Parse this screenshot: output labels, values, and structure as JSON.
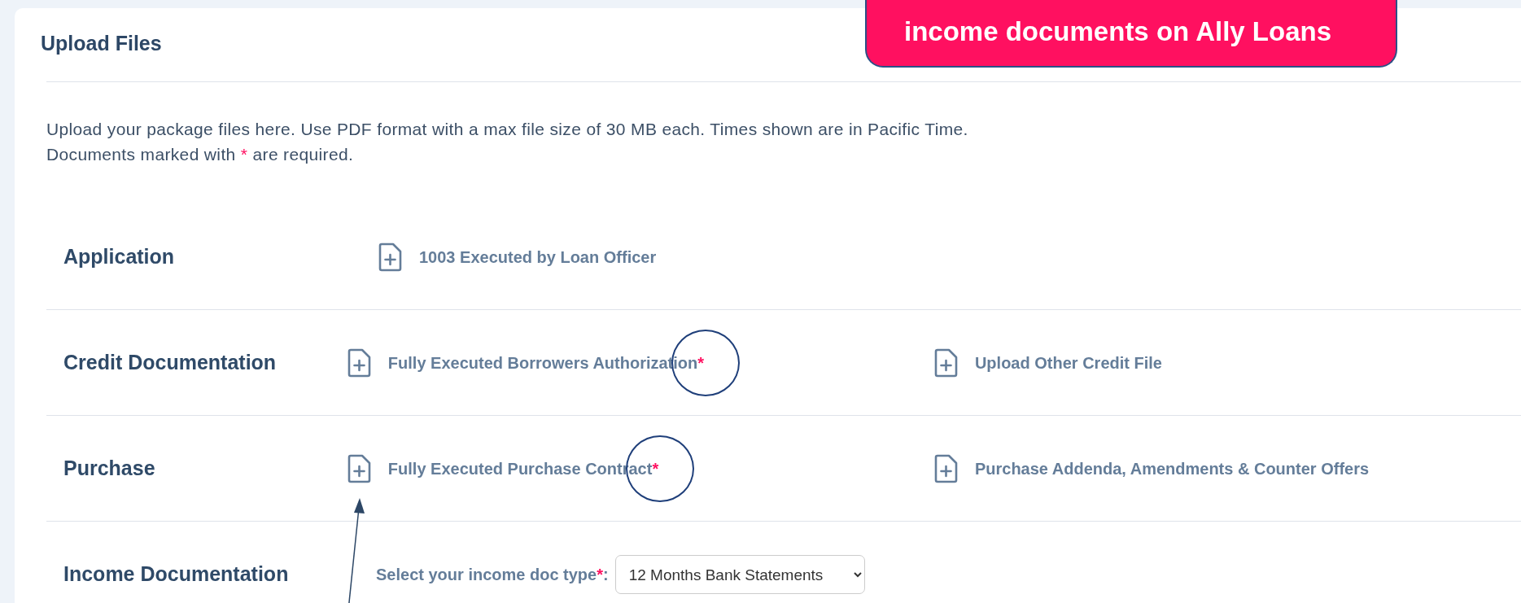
{
  "callout": {
    "text": "income documents on Ally Loans"
  },
  "card": {
    "title": "Upload Files",
    "description": "Upload your package files here. Use PDF format with a max file size of 30 MB each. Times shown are in Pacific Time.",
    "note": {
      "before": "Documents marked with",
      "mark": "*",
      "after": "are required."
    },
    "sections": [
      {
        "label": "Application",
        "kind": "files",
        "items": [
          {
            "label": "1003 Executed by Loan Officer",
            "required": false,
            "circled": false,
            "arrowed": false
          }
        ]
      },
      {
        "label": "Credit Documentation",
        "kind": "files",
        "items": [
          {
            "label": "Fully Executed Borrowers Authorization",
            "required": true,
            "circled": true,
            "arrowed": false
          },
          {
            "label": "Upload Other Credit File",
            "required": false,
            "circled": false,
            "arrowed": false
          }
        ]
      },
      {
        "label": "Purchase",
        "kind": "files",
        "items": [
          {
            "label": "Fully Executed Purchase Contract",
            "required": true,
            "circled": true,
            "arrowed": true
          },
          {
            "label": "Purchase Addenda, Amendments & Counter Offers",
            "required": false,
            "circled": false,
            "arrowed": false
          }
        ]
      },
      {
        "label": "Income Documentation",
        "kind": "select",
        "select_label": "Select your income doc type",
        "required": true,
        "select_suffix": ":",
        "value": "12 Months Bank Statements"
      }
    ]
  }
}
